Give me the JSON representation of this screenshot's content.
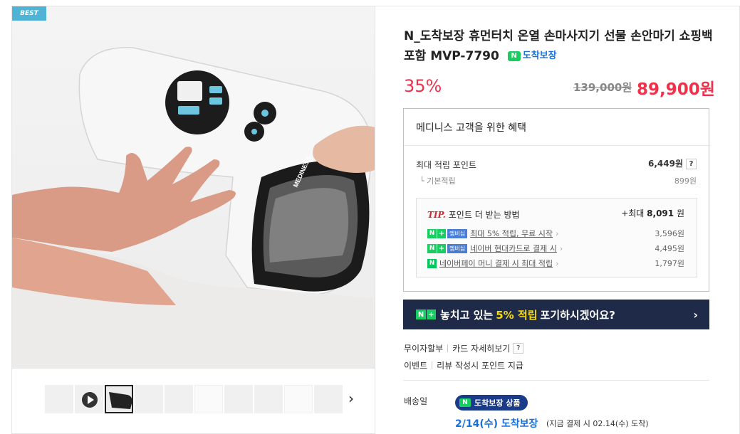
{
  "gallery": {
    "badge": "BEST",
    "brand_text": "MEDINESS",
    "thumb_count": 10,
    "active_thumb": 3
  },
  "product": {
    "title": "N_도착보장 휴먼터치 온열 손마사지기 선물 손안마기 쇼핑백 포함 MVP-7790",
    "arrival_chip_logo": "N",
    "arrival_chip_label": "도착보장",
    "discount": "35%",
    "original_price": "139,000원",
    "sale_price": "89,900원"
  },
  "benefits": {
    "heading": "메디니스 고객을 위한 혜택",
    "max_points_label": "최대 적립 포인트",
    "max_points_value": "6,449원",
    "help": "?",
    "base_label": "기본적립",
    "base_value": "899원",
    "tip": {
      "mark": "TIP.",
      "title": "포인트 더 받는 방법",
      "max_prefix": "+최대",
      "max_value": "8,091",
      "max_unit": "원",
      "items": [
        {
          "label": "최대 5% 적립, 무료 시작",
          "value": "3,596원",
          "member": "멤버십"
        },
        {
          "label": "네이버 현대카드로 결제 시",
          "value": "4,495원",
          "member": "멤버십"
        },
        {
          "label": "네이버페이 머니 결제 시 최대 적립",
          "value": "1,797원"
        }
      ]
    }
  },
  "promo": {
    "text_before": "놓치고 있는",
    "highlight": "5% 적립",
    "text_after": "포기하시겠어요?"
  },
  "links": {
    "installment": "무이자할부",
    "card_detail": "카드 자세히보기",
    "help": "?",
    "event": "이벤트",
    "review_points": "리뷰 작성시 포인트 지급"
  },
  "shipping": {
    "label": "배송일",
    "pill": "도착보장 상품",
    "date": "2/14(수) 도착보장",
    "note": "(지금 결제 시 02.14(수) 도착)"
  },
  "colors": {
    "accent_red": "#f0314b",
    "naver_green": "#19ce60",
    "banner_navy": "#1f2a48",
    "link_blue": "#1a6fd8"
  }
}
